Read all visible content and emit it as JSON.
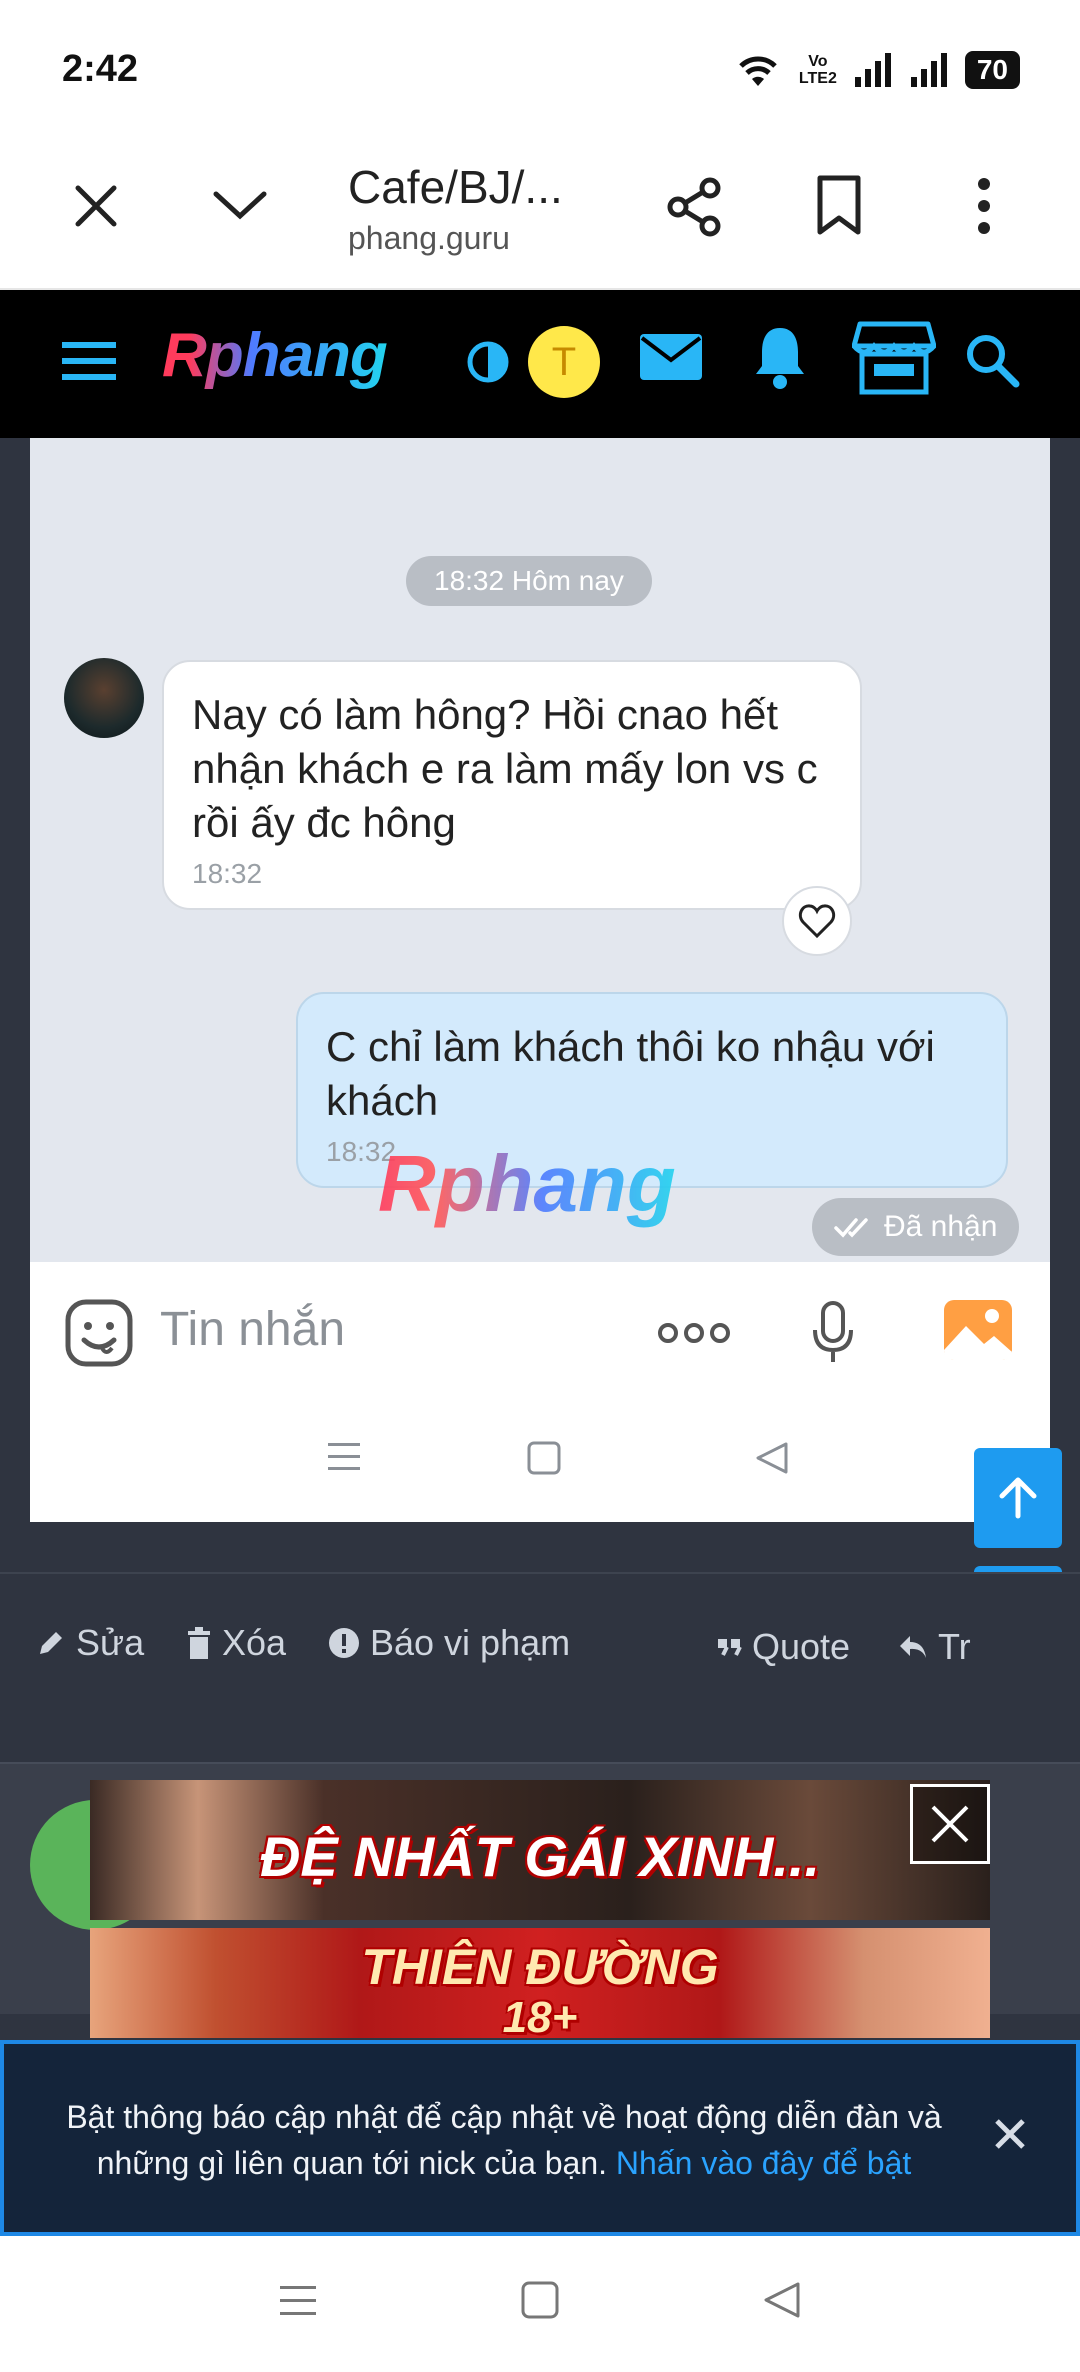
{
  "status_bar": {
    "time": "2:42",
    "volte_top": "Vo",
    "volte_bottom": "LTE2",
    "battery": "70"
  },
  "browser": {
    "title": "Cafe/BJ/...",
    "url": "phang.guru"
  },
  "site_header": {
    "logo": "Rphang",
    "user_initial": "T"
  },
  "chat": {
    "time_separator": "18:32 Hôm nay",
    "incoming": {
      "text": "Nay có làm hông? Hồi cnao hết nhận khách e ra làm mấy lon vs c rồi ấy đc hông",
      "time": "18:32"
    },
    "outgoing": {
      "text": "C chỉ làm khách thôi ko nhậu với khách",
      "time": "18:32"
    },
    "watermark": "Rphang",
    "status": "Đã nhận",
    "input_placeholder": "Tin nhắn"
  },
  "post_actions": {
    "edit": "Sửa",
    "delete": "Xóa",
    "report": "Báo vi phạm",
    "quote": "Quote",
    "reply": "Tr"
  },
  "ads": {
    "banner1": "ĐỆ NHẤT GÁI XINH...",
    "banner2_line1": "THIÊN ĐƯỜNG",
    "banner2_line2": "18+"
  },
  "notification": {
    "text": "Bật thông báo cập nhật để cập nhật về hoạt động diễn đàn và những gì liên quan tới nick của bạn.",
    "link": "Nhấn vào đây để bật"
  },
  "colors": {
    "accent": "#1e9bf0",
    "header_bg": "#000000",
    "page_bg": "#2f3440",
    "bubble_out": "#d3eafc"
  }
}
